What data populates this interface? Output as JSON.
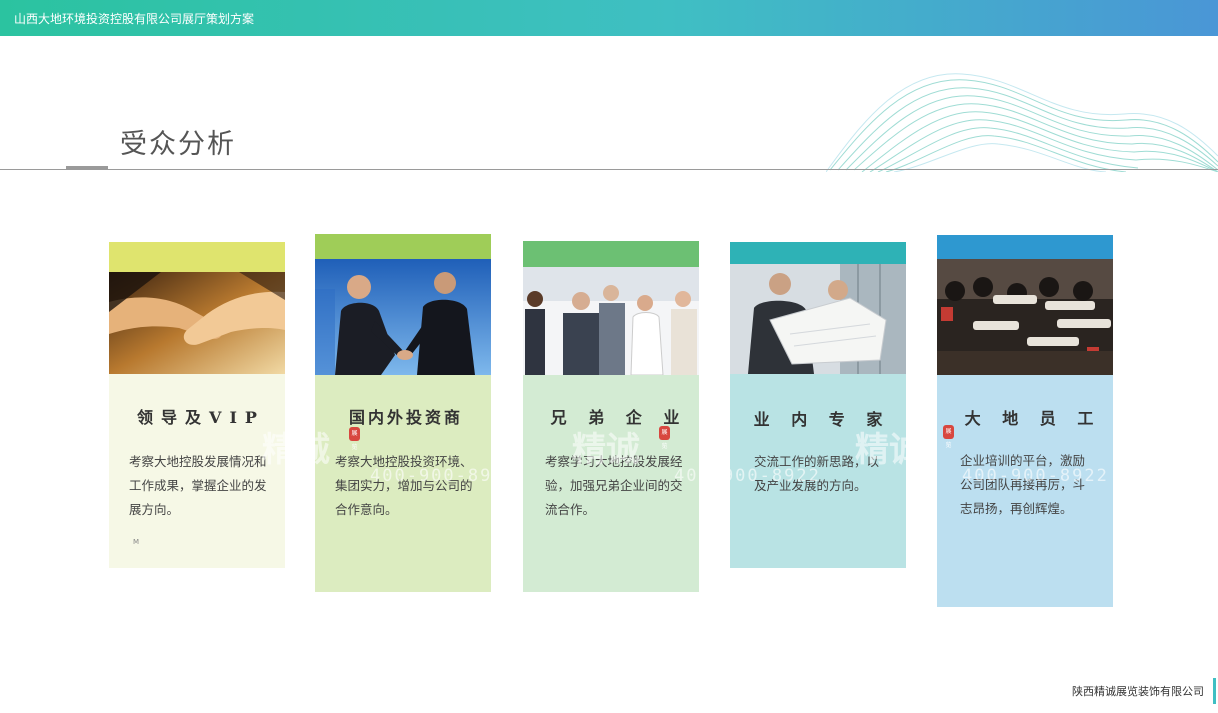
{
  "header": {
    "title": "山西大地环境投资控股有限公司展厅策划方案"
  },
  "section": {
    "title": "受众分析"
  },
  "cards": [
    {
      "heading": "领导及VIP",
      "description": "考察大地控股发展情况和工作成果，掌握企业的发展方向。",
      "note": "M",
      "photo": "handshake-closeup",
      "band_color": "#dfe46e",
      "body_color": "#f6f8e6"
    },
    {
      "heading": "国内外投资商",
      "description": "考察大地控股投资环境、集团实力，增加与公司的合作意向。",
      "photo": "business-handshake",
      "band_color": "#9fcd58",
      "body_color": "#dcecc0"
    },
    {
      "heading": "兄 弟 企 业",
      "description": "考察学习大地控股发展经验，加强兄弟企业间的交流合作。",
      "photo": "business-team",
      "band_color": "#6cc073",
      "body_color": "#d3ebd3"
    },
    {
      "heading": "业 内 专 家",
      "description": "交流工作的新思路，以及产业发展的方向。",
      "photo": "experts-with-blueprint",
      "band_color": "#2eb2b6",
      "body_color": "#b9e3e4"
    },
    {
      "heading": "大 地 员 工",
      "description": "企业培训的平台，激励公司团队再接再厉，斗志昂扬，再创辉煌。",
      "photo": "photographers-crowd",
      "band_color": "#2e98d0",
      "body_color": "#bcdff0"
    }
  ],
  "seal_text": "展览",
  "watermark": {
    "text": "精诚",
    "phone": "400-900-8922"
  },
  "footer": {
    "company": "陕西精诚展览装饰有限公司"
  }
}
